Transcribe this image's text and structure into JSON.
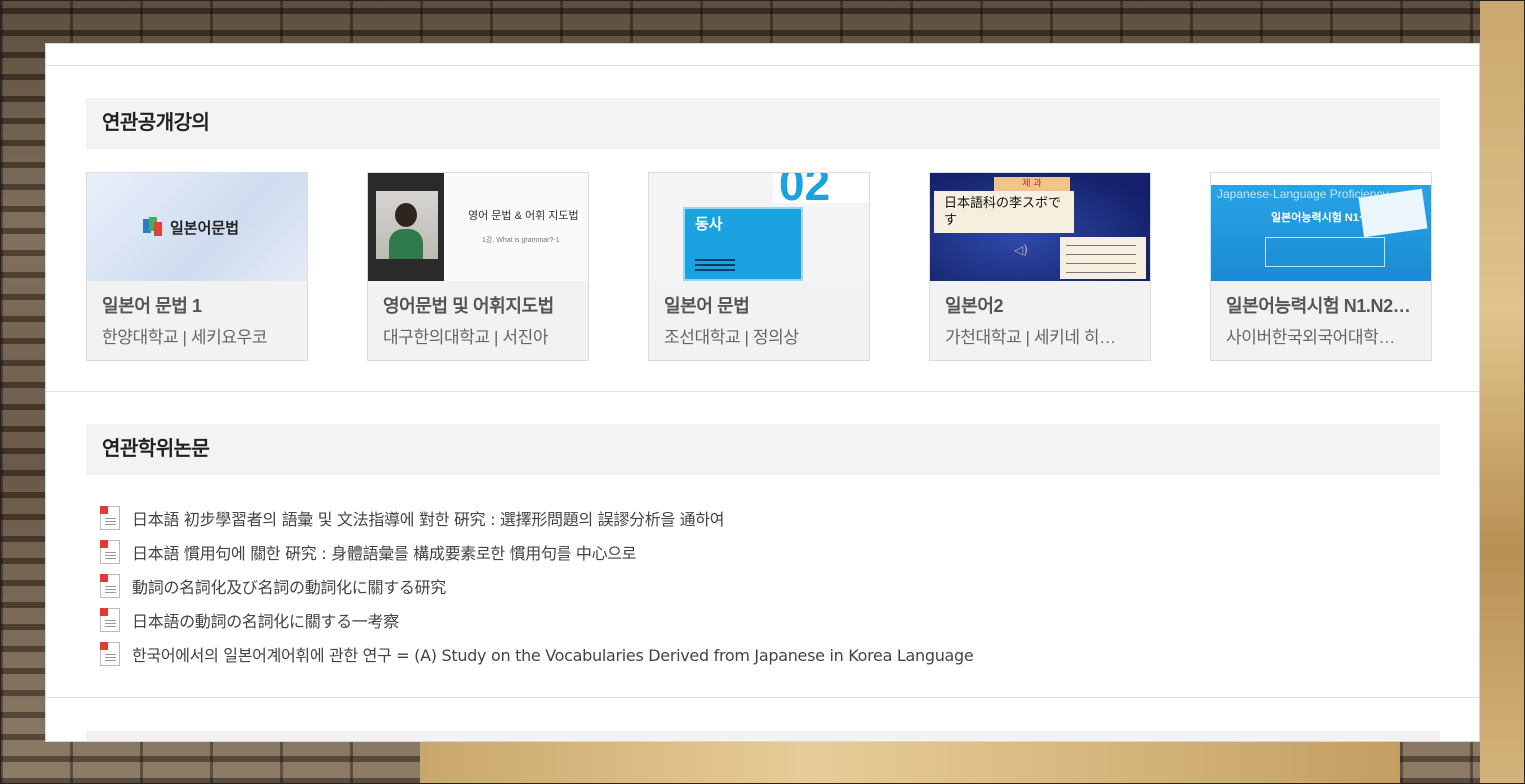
{
  "sections": {
    "lectures_title": "연관공개강의",
    "theses_title": "연관학위논문"
  },
  "lectures": [
    {
      "title": "일본어 문법 1",
      "subtitle": "한양대학교 | 세키요우코",
      "thumb_text": "일본어문법"
    },
    {
      "title": "영어문법 및 어휘지도법",
      "subtitle": "대구한의대학교 | 서진아",
      "thumb_text": "영어 문법 & 어휘 지도법",
      "thumb_sub": "1강. What is grammar?-1"
    },
    {
      "title": "일본어 문법",
      "subtitle": "조선대학교 | 정의상",
      "thumb_text": "동사",
      "thumb_num": "02"
    },
    {
      "title": "일본어2",
      "subtitle": "가천대학교 | 세키네 히…",
      "thumb_text": "日本語科の李スボです",
      "thumb_tag": "제 과"
    },
    {
      "title": "일본어능력시험 N1.N2…",
      "subtitle": "사이버한국외국어대학…",
      "thumb_text": "일본어능력시험 N1·N2대비",
      "thumb_sub": "Japanese-Language Proficiency"
    }
  ],
  "theses": [
    "日本語 初步學習者의 語彙 및 文法指導에 對한 硏究 : 選擇形問題의 誤謬分析을 通하여",
    "日本語 慣用句에 關한 硏究 : 身體語彙를 構成要素로한 慣用句를 中心으로",
    "動詞の名詞化及び名詞の動詞化に關する研究",
    "日本語の動詞の名詞化に關する一考察",
    "한국어에서의 일본어계어휘에 관한 연구 = (A) Study on the Vocabularies Derived from Japanese in Korea Language"
  ],
  "icons": {
    "thesis_icon": "document-icon"
  },
  "colors": {
    "header_bg": "#f3f3f3",
    "doc_icon_accent": "#e53935",
    "thumb4_bg": "#1a2c7a",
    "thumb3_bg": "#1aa3e0"
  }
}
